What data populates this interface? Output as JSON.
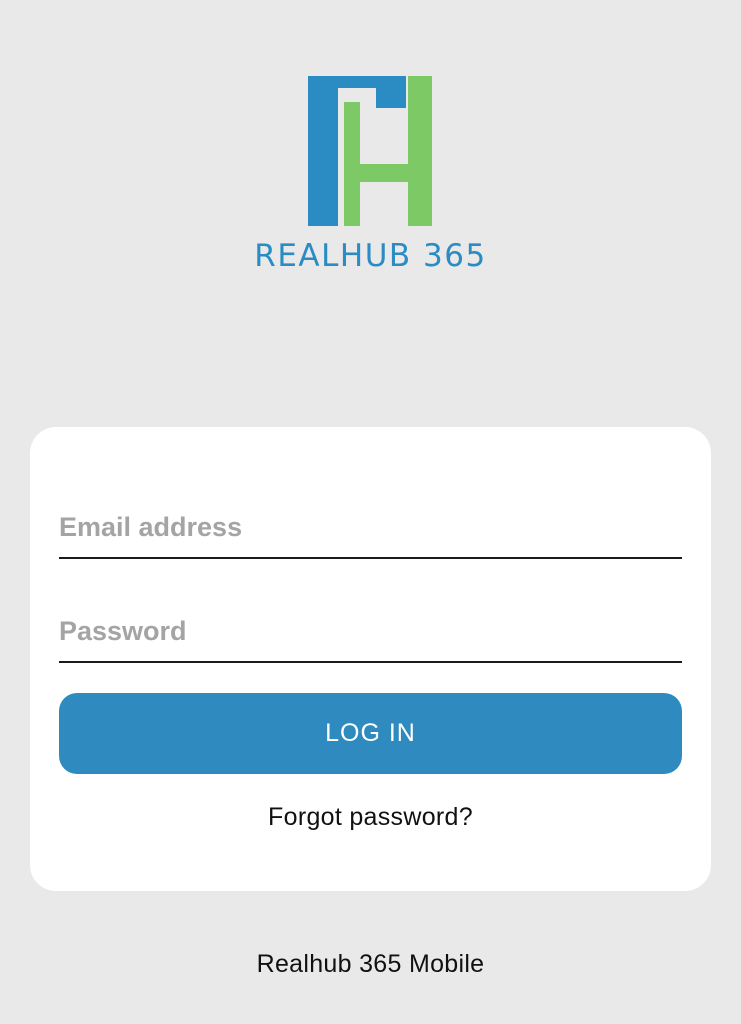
{
  "brand": {
    "name": "REALHUB 365",
    "logo_icon": "realhub-rh-logo-icon",
    "primary_color": "#2b8cc4",
    "secondary_color": "#7cc966"
  },
  "login_form": {
    "email_placeholder": "Email address",
    "email_value": "",
    "password_placeholder": "Password",
    "password_value": "",
    "login_button_label": "LOG IN",
    "forgot_password_label": "Forgot password?"
  },
  "footer": {
    "text": "Realhub 365 Mobile"
  },
  "colors": {
    "background": "#e9e9e9",
    "card": "#ffffff",
    "button": "#2f8bbf",
    "placeholder": "#a4a4a4"
  }
}
